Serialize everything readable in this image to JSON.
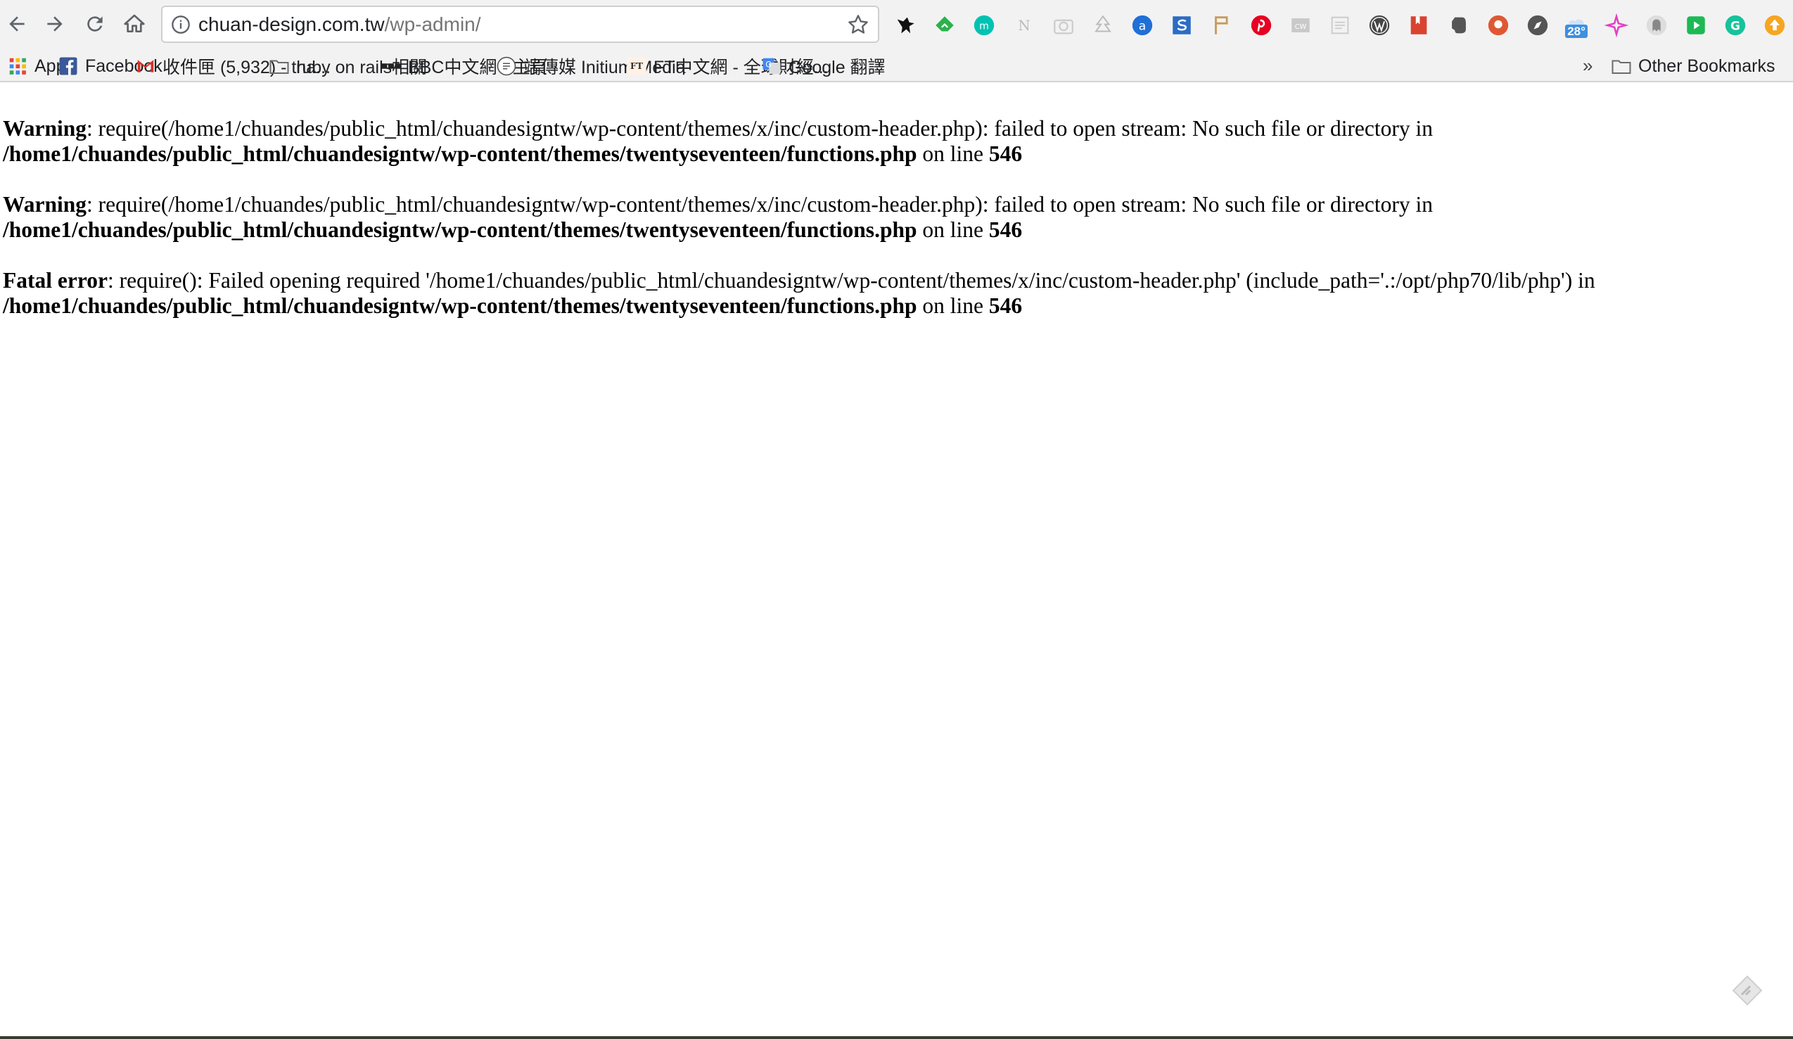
{
  "browser": {
    "url_host": "chuan-design.com.tw",
    "url_path": "/wp-admin/",
    "nav": [
      "back-icon",
      "forward-icon",
      "reload-icon",
      "home-icon"
    ],
    "extensions": [
      {
        "name": "nightcrawler-ext-icon",
        "color": "#111111"
      },
      {
        "name": "feedly-ext-icon",
        "color": "#2bb24c"
      },
      {
        "name": "medium-ext-icon",
        "color": "#00c2b2"
      },
      {
        "name": "notion-ext-icon",
        "color": "#bbbbbb"
      },
      {
        "name": "camera-ext-icon",
        "color": "#cccccc"
      },
      {
        "name": "tree-ext-icon",
        "color": "#bbbbbb"
      },
      {
        "name": "amazon-assistant-ext-icon",
        "color": "#1f6fd6"
      },
      {
        "name": "shutterstock-ext-icon",
        "color": "#2b6cc4"
      },
      {
        "name": "pin-flag-ext-icon",
        "color": "#c89a5a"
      },
      {
        "name": "pinterest-ext-icon",
        "color": "#e60023"
      },
      {
        "name": "cw-ext-icon",
        "color": "#c9c9c9"
      },
      {
        "name": "reader-ext-icon",
        "color": "#cccccc"
      },
      {
        "name": "wordpress-ext-icon",
        "color": "#464646"
      },
      {
        "name": "bookmark-red-ext-icon",
        "color": "#d9432f"
      },
      {
        "name": "evernote-ext-icon",
        "color": "#555555"
      },
      {
        "name": "duckduckgo-ext-icon",
        "color": "#de5833"
      },
      {
        "name": "compass-ext-icon",
        "color": "#555555"
      },
      {
        "name": "weather-ext-icon",
        "color": "#3d8fe0",
        "label": "28°"
      },
      {
        "name": "sparkle-ext-icon",
        "color": "#e23fc6"
      },
      {
        "name": "ghostery-ext-icon",
        "color": "#888888"
      },
      {
        "name": "play-ext-icon",
        "color": "#1db954"
      },
      {
        "name": "grammarly-ext-icon",
        "color": "#15c39a"
      },
      {
        "name": "upload-ext-icon",
        "color": "#f5a623"
      }
    ]
  },
  "bookmarks": {
    "items": [
      {
        "label": "Apps",
        "icon": "apps-grid-icon"
      },
      {
        "label": "Facebook",
        "icon": "facebook-icon"
      },
      {
        "label": "收件匣 (5,932) - tha...",
        "icon": "gmail-icon"
      },
      {
        "label": "ruby on rails相關",
        "icon": "folder-icon"
      },
      {
        "label": "BBC中文網 - 主頁",
        "icon": "bbc-icon"
      },
      {
        "label": "端傳媒 Initium Media",
        "icon": "initium-icon"
      },
      {
        "label": "FT中文網 - 全球財經...",
        "icon": "ft-icon"
      },
      {
        "label": "Google 翻譯",
        "icon": "google-translate-icon"
      }
    ],
    "overflow": "»",
    "other": "Other Bookmarks"
  },
  "errors": [
    {
      "type": "Warning",
      "message": ": require(/home1/chuandes/public_html/chuandesigntw/wp-content/themes/x/inc/custom-header.php): failed to open stream: No such file or directory in",
      "file": "/home1/chuandes/public_html/chuandesigntw/wp-content/themes/twentyseventeen/functions.php",
      "line_text": " on line ",
      "line": "546"
    },
    {
      "type": "Warning",
      "message": ": require(/home1/chuandes/public_html/chuandesigntw/wp-content/themes/x/inc/custom-header.php): failed to open stream: No such file or directory in",
      "file": "/home1/chuandes/public_html/chuandesigntw/wp-content/themes/twentyseventeen/functions.php",
      "line_text": " on line ",
      "line": "546"
    },
    {
      "type": "Fatal error",
      "message": ": require(): Failed opening required '/home1/chuandes/public_html/chuandesigntw/wp-content/themes/x/inc/custom-header.php' (include_path='.:/opt/php70/lib/php') in",
      "file": "/home1/chuandes/public_html/chuandesigntw/wp-content/themes/twentyseventeen/functions.php",
      "line_text": " on line ",
      "line": "546"
    }
  ]
}
